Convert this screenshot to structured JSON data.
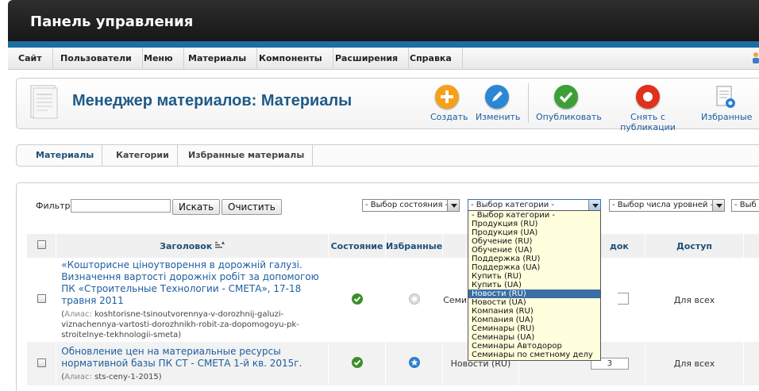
{
  "header": {
    "title": "Панель управления"
  },
  "menu": [
    {
      "label": "Сайт"
    },
    {
      "label": "Пользователи"
    },
    {
      "label": "Меню"
    },
    {
      "label": "Материалы"
    },
    {
      "label": "Компоненты"
    },
    {
      "label": "Расширения"
    },
    {
      "label": "Справка"
    }
  ],
  "toolbar": {
    "title": "Менеджер материалов: Материалы",
    "buttons": {
      "create": "Создать",
      "edit": "Изменить",
      "publish": "Опубликовать",
      "unpublish": "Снять с публикации",
      "featured": "Избранные"
    }
  },
  "tabs": [
    "Материалы",
    "Категории",
    "Избранные материалы"
  ],
  "filter": {
    "label": "Фильтр:",
    "value": "",
    "search_button": "Искать",
    "clear_button": "Очистить",
    "state_select": "- Выбор состояния -",
    "category_select": "- Выбор категории -",
    "levels_select": "- Выбор числа уровней -",
    "extra_select": "- Выб"
  },
  "table": {
    "headers": {
      "title": "Заголовок",
      "state": "Состояние",
      "featured": "Избранные",
      "order_partial": "док",
      "access": "Доступ"
    },
    "rows": [
      {
        "title": "«Кошторисне ціноутворення в дорожній галузі. Визначення вартості дорожніх робіт за допомогою ПК «Строительные Технологии - СМЕТА», 17-18 травня 2011",
        "alias_label": "Алиас:",
        "alias": "koshtorisne-tsinoutvorennya-v-dorozhnij-galuzi-viznachennya-vartosti-dorozhnikh-robit-za-dopomogoyu-pk-stroitelnye-tekhnologii-smeta",
        "category_partial": "Семи",
        "order": "",
        "access": "Для всех"
      },
      {
        "title": "Обновление цен на материальные ресурсы нормативной базы ПК СТ - СМЕТА 1-й кв. 2015г.",
        "alias_label": "Алиас:",
        "alias": "sts-ceny-1-2015",
        "category": "Новости (RU)",
        "order": "3",
        "access": "Для всех"
      }
    ]
  },
  "dropdown": {
    "selected_index": 9,
    "options": [
      "- Выбор категории -",
      "Продукция (RU)",
      "Продукция (UA)",
      "Обучение (RU)",
      "Обучение (UA)",
      "Поддержка (RU)",
      "Поддержка (UA)",
      "Купить (RU)",
      "Купить (UA)",
      "Новости (RU)",
      "Новости (UA)",
      "Компания (RU)",
      "Компания (UA)",
      "Семинары (RU)",
      "Семинары (UA)",
      "Семинары Автодорор",
      "Семинары по сметному делу"
    ]
  },
  "colors": {
    "accent": "#1c6fa3",
    "create": "#f6a01a",
    "edit": "#2c86d4",
    "publish": "#3ca037",
    "unpublish": "#e0301e",
    "link": "#1d5fa0"
  }
}
